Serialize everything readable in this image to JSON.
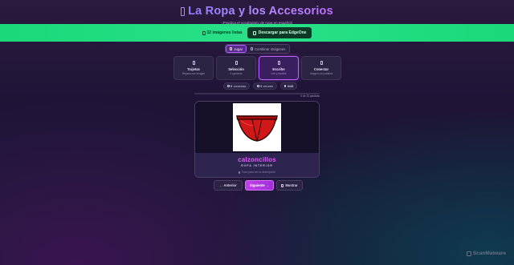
{
  "header": {
    "title_icon": "box-glyph",
    "title": "La Ropa y los Accesorios",
    "subtitle": "¡Practica el vocabulario de ropa en español!"
  },
  "banner": {
    "icon": "box-glyph",
    "text": "32 imágenes listas",
    "button_icon": "box-glyph",
    "button_label": "Descargar para EdgeOne",
    "color": "#1fdc80"
  },
  "mode_toggle": {
    "play": {
      "icon": "box-glyph",
      "label": "Jugar"
    },
    "combine": {
      "icon": "box-glyph",
      "label": "Combinar imágenes"
    }
  },
  "game_modes": [
    {
      "icon": "box-glyph",
      "label": "Tarjetas",
      "sub": "Repasa con imagen",
      "active": false
    },
    {
      "icon": "box-glyph",
      "label": "Selección",
      "sub": "4 opciones",
      "active": false
    },
    {
      "icon": "box-glyph",
      "label": "Escribe",
      "sub": "Lee y escribe",
      "active": true
    },
    {
      "icon": "box-glyph",
      "label": "Conectar",
      "sub": "Imagen con palabra",
      "active": false
    }
  ],
  "stats": {
    "correct": {
      "icon": "box-glyph",
      "value": "0",
      "label": "correctas"
    },
    "errors": {
      "icon": "box-glyph",
      "value": "0",
      "label": "errores"
    },
    "progress": {
      "icon": "box-glyph",
      "value": "0/43"
    }
  },
  "progress": {
    "label": "0 de 43 palabras",
    "fraction": 0.0
  },
  "flashcard": {
    "image": "red-underwear-illustration",
    "word": "calzoncillos",
    "category": "ROPA INTERIOR",
    "hint_icon": "box-glyph",
    "hint": "Toca para ver la descripción"
  },
  "nav": {
    "prev_label": "← Anterior",
    "next_label": "Siguiente →",
    "show_icon": "box-glyph",
    "show_label": "Mostrar"
  },
  "watermark": {
    "icon": "scanmalware-logo",
    "text": "ScanMalware"
  },
  "colors": {
    "accent": "#c060ff",
    "word": "#e05aff",
    "banner": "#1fdc80"
  }
}
